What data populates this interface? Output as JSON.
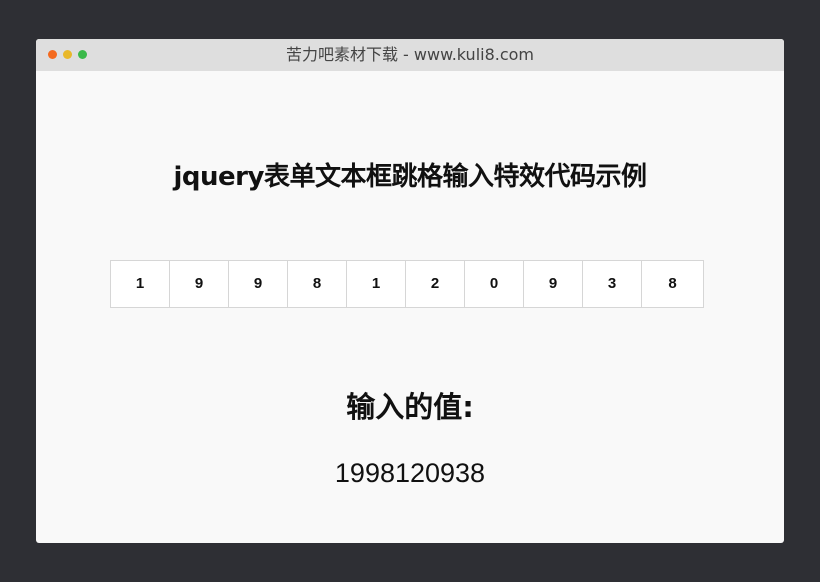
{
  "window": {
    "title": "苦力吧素材下载 - www.kuli8.com"
  },
  "page": {
    "heading": "jquery表单文本框跳格输入特效代码示例",
    "digits": [
      "1",
      "9",
      "9",
      "8",
      "1",
      "2",
      "0",
      "9",
      "3",
      "8"
    ],
    "value_label": "输入的值:",
    "value": "1998120938"
  },
  "colors": {
    "background": "#2e2f34",
    "window": "#f9f9f9",
    "titlebar": "#dedede",
    "dot_red": "#f46a1f",
    "dot_yellow": "#e8b82a",
    "dot_green": "#3bb94a"
  }
}
